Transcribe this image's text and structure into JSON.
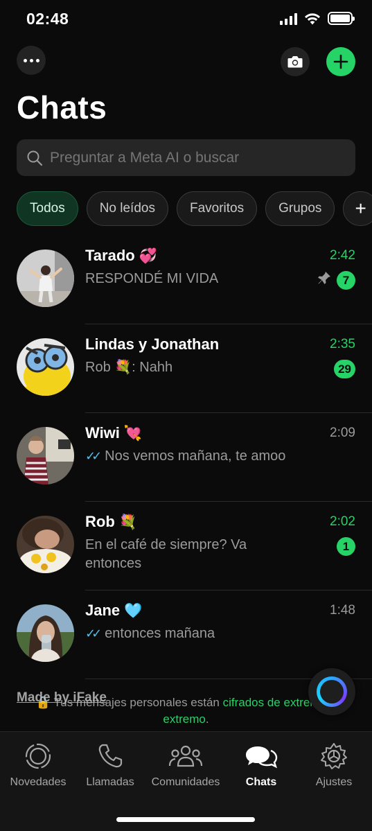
{
  "status_bar": {
    "time": "02:48"
  },
  "header": {
    "title": "Chats"
  },
  "search": {
    "placeholder": "Preguntar a Meta AI o buscar"
  },
  "filters": [
    "Todos",
    "No leídos",
    "Favoritos",
    "Grupos",
    "+"
  ],
  "chats": [
    {
      "name": "Tarado",
      "emoji": "💞",
      "preview": "RESPONDÉ MI VIDA",
      "time": "2:42",
      "unread": "7",
      "pinned": true,
      "read_ticks": false
    },
    {
      "name": "Lindas y Jonathan",
      "emoji": "",
      "preview": "Rob 💐: Nahh",
      "time": "2:35",
      "unread": "29",
      "pinned": false,
      "read_ticks": false
    },
    {
      "name": "Wiwi",
      "emoji": "💘",
      "preview": "Nos vemos mañana, te amoo",
      "time": "2:09",
      "unread": "",
      "pinned": false,
      "read_ticks": true
    },
    {
      "name": "Rob",
      "emoji": "💐",
      "preview": "En el café de siempre? Va entonces",
      "time": "2:02",
      "unread": "1",
      "pinned": false,
      "read_ticks": false
    },
    {
      "name": "Jane",
      "emoji": "🩵",
      "preview": "entonces mañana",
      "time": "1:48",
      "unread": "",
      "pinned": false,
      "read_ticks": true
    }
  ],
  "footer_note": {
    "text": "Tus mensajes personales están ",
    "link": "cifrados de extremo a extremo",
    "end": "."
  },
  "watermark": "Made by iFake",
  "tabs": [
    {
      "label": "Novedades",
      "icon": "updates-icon"
    },
    {
      "label": "Llamadas",
      "icon": "phone-icon"
    },
    {
      "label": "Comunidades",
      "icon": "communities-icon"
    },
    {
      "label": "Chats",
      "icon": "chats-icon",
      "active": true
    },
    {
      "label": "Ajustes",
      "icon": "settings-icon"
    }
  ],
  "colors": {
    "accent": "#25d366",
    "background": "#0b0b0b",
    "read_ticks": "#53bdeb"
  }
}
